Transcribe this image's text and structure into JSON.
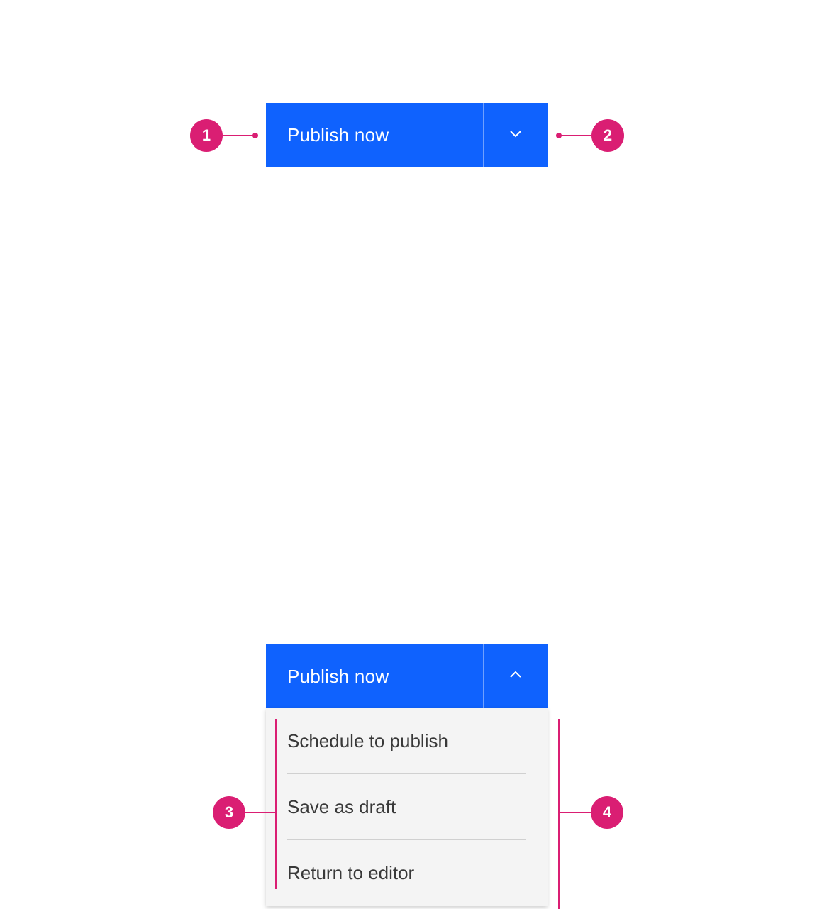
{
  "splitButton": {
    "primaryLabel": "Publish now",
    "menuItems": [
      {
        "label": "Schedule to publish"
      },
      {
        "label": "Save as draft"
      },
      {
        "label": "Return to editor"
      }
    ]
  },
  "annotations": {
    "a1": "1",
    "a2": "2",
    "a3": "3",
    "a4": "4"
  }
}
